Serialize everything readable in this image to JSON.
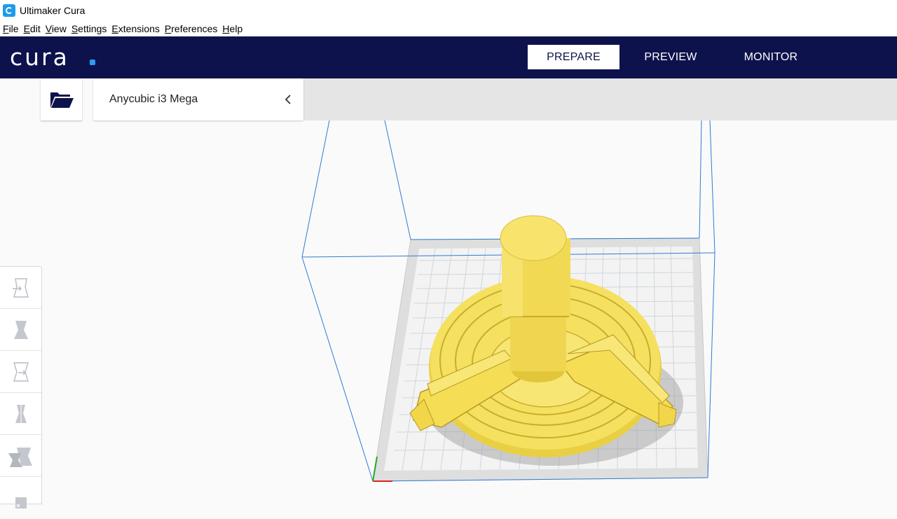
{
  "window": {
    "title": "Ultimaker Cura",
    "app_icon": "cura-app-icon"
  },
  "menubar": [
    "File",
    "Edit",
    "View",
    "Settings",
    "Extensions",
    "Preferences",
    "Help"
  ],
  "header": {
    "logo_text": "cura",
    "logo_dot_color": "#2d9bf0",
    "background": "#0e124c",
    "stages": [
      {
        "label": "PREPARE",
        "active": true
      },
      {
        "label": "PREVIEW",
        "active": false
      },
      {
        "label": "MONITOR",
        "active": false
      }
    ]
  },
  "toolbar": {
    "open_icon": "folder-open-icon",
    "printer_name": "Anycubic i3 Mega",
    "collapse_icon": "chevron-left-icon"
  },
  "tools": [
    "move-tool-icon",
    "scale-tool-icon",
    "rotate-tool-icon",
    "mirror-tool-icon",
    "per-model-settings-icon",
    "support-blocker-icon"
  ],
  "model": {
    "color": "#f5e060",
    "description": "3D model on build plate"
  }
}
